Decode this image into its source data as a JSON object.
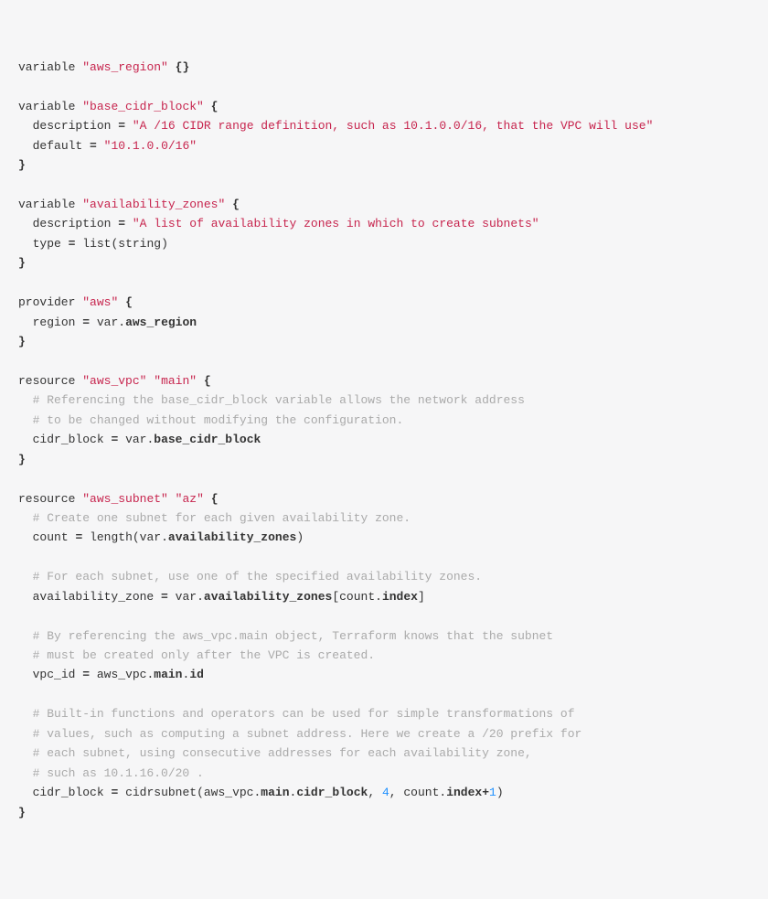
{
  "code": {
    "v1_kw": "variable",
    "v1_name": "\"aws_region\"",
    "v2_kw": "variable",
    "v2_name": "\"base_cidr_block\"",
    "v2_desc_key": "description",
    "v2_desc_val": "\"A /16 CIDR range definition, such as 10.1.0.0/16, that the VPC will use\"",
    "v2_def_key": "default",
    "v2_def_val": "\"10.1.0.0/16\"",
    "v3_kw": "variable",
    "v3_name": "\"availability_zones\"",
    "v3_desc_key": "description",
    "v3_desc_val": "\"A list of availability zones in which to create subnets\"",
    "v3_type_key": "type",
    "v3_type_val": "list(string)",
    "p_kw": "provider",
    "p_name": "\"aws\"",
    "p_region_key": "region",
    "p_region_val1": "var.",
    "p_region_val2": "aws_region",
    "r1_kw": "resource",
    "r1_type": "\"aws_vpc\"",
    "r1_name": "\"main\"",
    "r1_c1": "# Referencing the base_cidr_block variable allows the network address",
    "r1_c2": "# to be changed without modifying the configuration.",
    "r1_cidr_key": "cidr_block",
    "r1_cidr_val1": "var.",
    "r1_cidr_val2": "base_cidr_block",
    "r2_kw": "resource",
    "r2_type": "\"aws_subnet\"",
    "r2_name": "\"az\"",
    "r2_c1": "# Create one subnet for each given availability zone.",
    "r2_count_key": "count",
    "r2_count_pre": "length(var.",
    "r2_count_mid": "availability_zones",
    "r2_count_post": ")",
    "r2_c2": "# For each subnet, use one of the specified availability zones.",
    "r2_az_key": "availability_zone",
    "r2_az_v1": "var.",
    "r2_az_v2": "availability_zones",
    "r2_az_v3": "[count.",
    "r2_az_v4": "index",
    "r2_az_v5": "]",
    "r2_c3": "# By referencing the aws_vpc.main object, Terraform knows that the subnet",
    "r2_c4": "# must be created only after the VPC is created.",
    "r2_vpc_key": "vpc_id",
    "r2_vpc_v1": "aws_vpc.",
    "r2_vpc_v2": "main",
    "r2_vpc_v3": ".",
    "r2_vpc_v4": "id",
    "r2_c5": "# Built-in functions and operators can be used for simple transformations of",
    "r2_c6": "# values, such as computing a subnet address. Here we create a /20 prefix for",
    "r2_c7": "# each subnet, using consecutive addresses for each availability zone,",
    "r2_c8": "# such as 10.1.16.0/20 .",
    "r2_cb_key": "cidr_block",
    "r2_cb_v1": "cidrsubnet(aws_vpc.",
    "r2_cb_v2": "main",
    "r2_cb_v3": ".",
    "r2_cb_v4": "cidr_block",
    "r2_cb_v5": ", ",
    "r2_cb_n1": "4",
    "r2_cb_v6": ", count.",
    "r2_cb_v7": "index",
    "r2_cb_op": "+",
    "r2_cb_n2": "1",
    "r2_cb_v8": ")"
  }
}
